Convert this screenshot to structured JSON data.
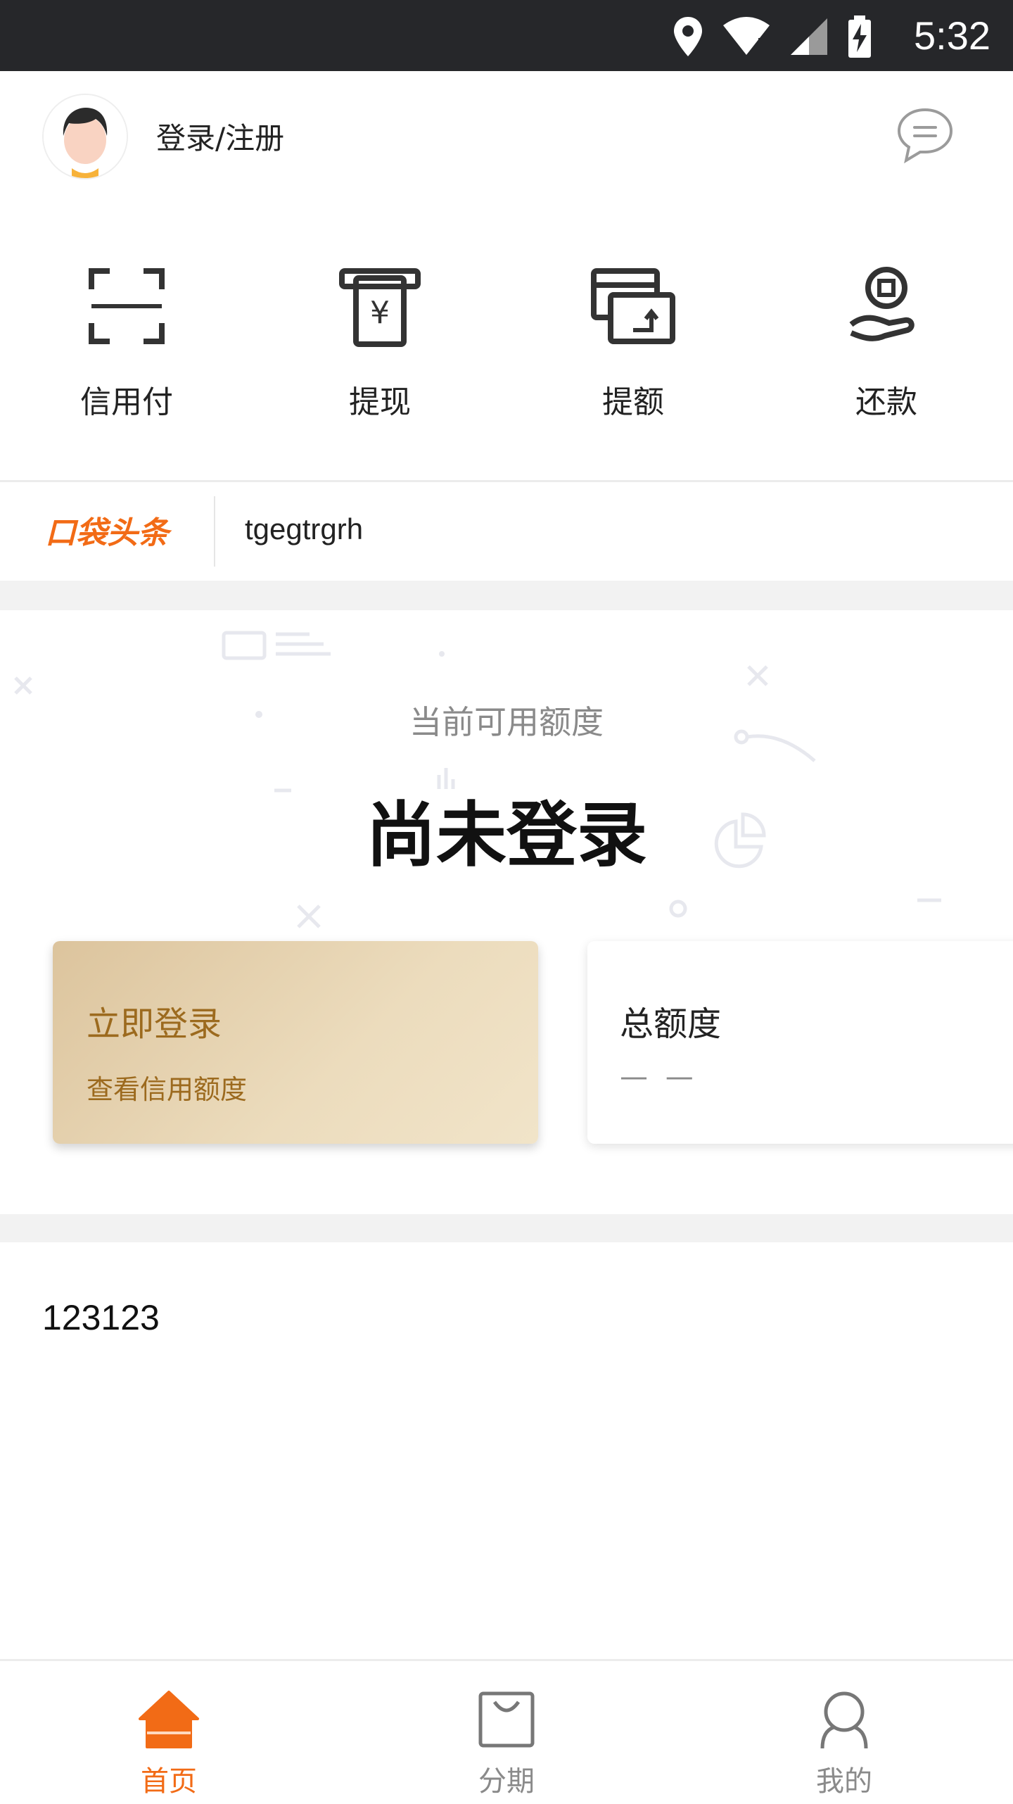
{
  "status_bar": {
    "time": "5:32",
    "icons": [
      "location-icon",
      "wifi-icon",
      "signal-icon",
      "battery-charging-icon"
    ]
  },
  "header": {
    "login_label": "登录/注册",
    "message_icon": "message-icon"
  },
  "actions": [
    {
      "label": "信用付",
      "icon": "scan-icon"
    },
    {
      "label": "提现",
      "icon": "withdraw-icon"
    },
    {
      "label": "提额",
      "icon": "raise-limit-icon"
    },
    {
      "label": "还款",
      "icon": "repay-icon"
    }
  ],
  "news": {
    "logo_text": "口袋头条",
    "headline": "tgegtrgrh"
  },
  "credit": {
    "caption": "当前可用额度",
    "status": "尚未登录",
    "login_card": {
      "title": "立即登录",
      "subtitle": "查看信用额度"
    },
    "total_card": {
      "title": "总额度",
      "value": "— —"
    }
  },
  "section": {
    "title": "123123"
  },
  "tabbar": {
    "items": [
      {
        "label": "首页",
        "icon": "home-icon",
        "active": true
      },
      {
        "label": "分期",
        "icon": "bag-icon",
        "active": false
      },
      {
        "label": "我的",
        "icon": "user-icon",
        "active": false
      }
    ]
  },
  "colors": {
    "accent": "#f26b16",
    "gold_text": "#9c6a1e",
    "status_bar": "#26272a"
  }
}
